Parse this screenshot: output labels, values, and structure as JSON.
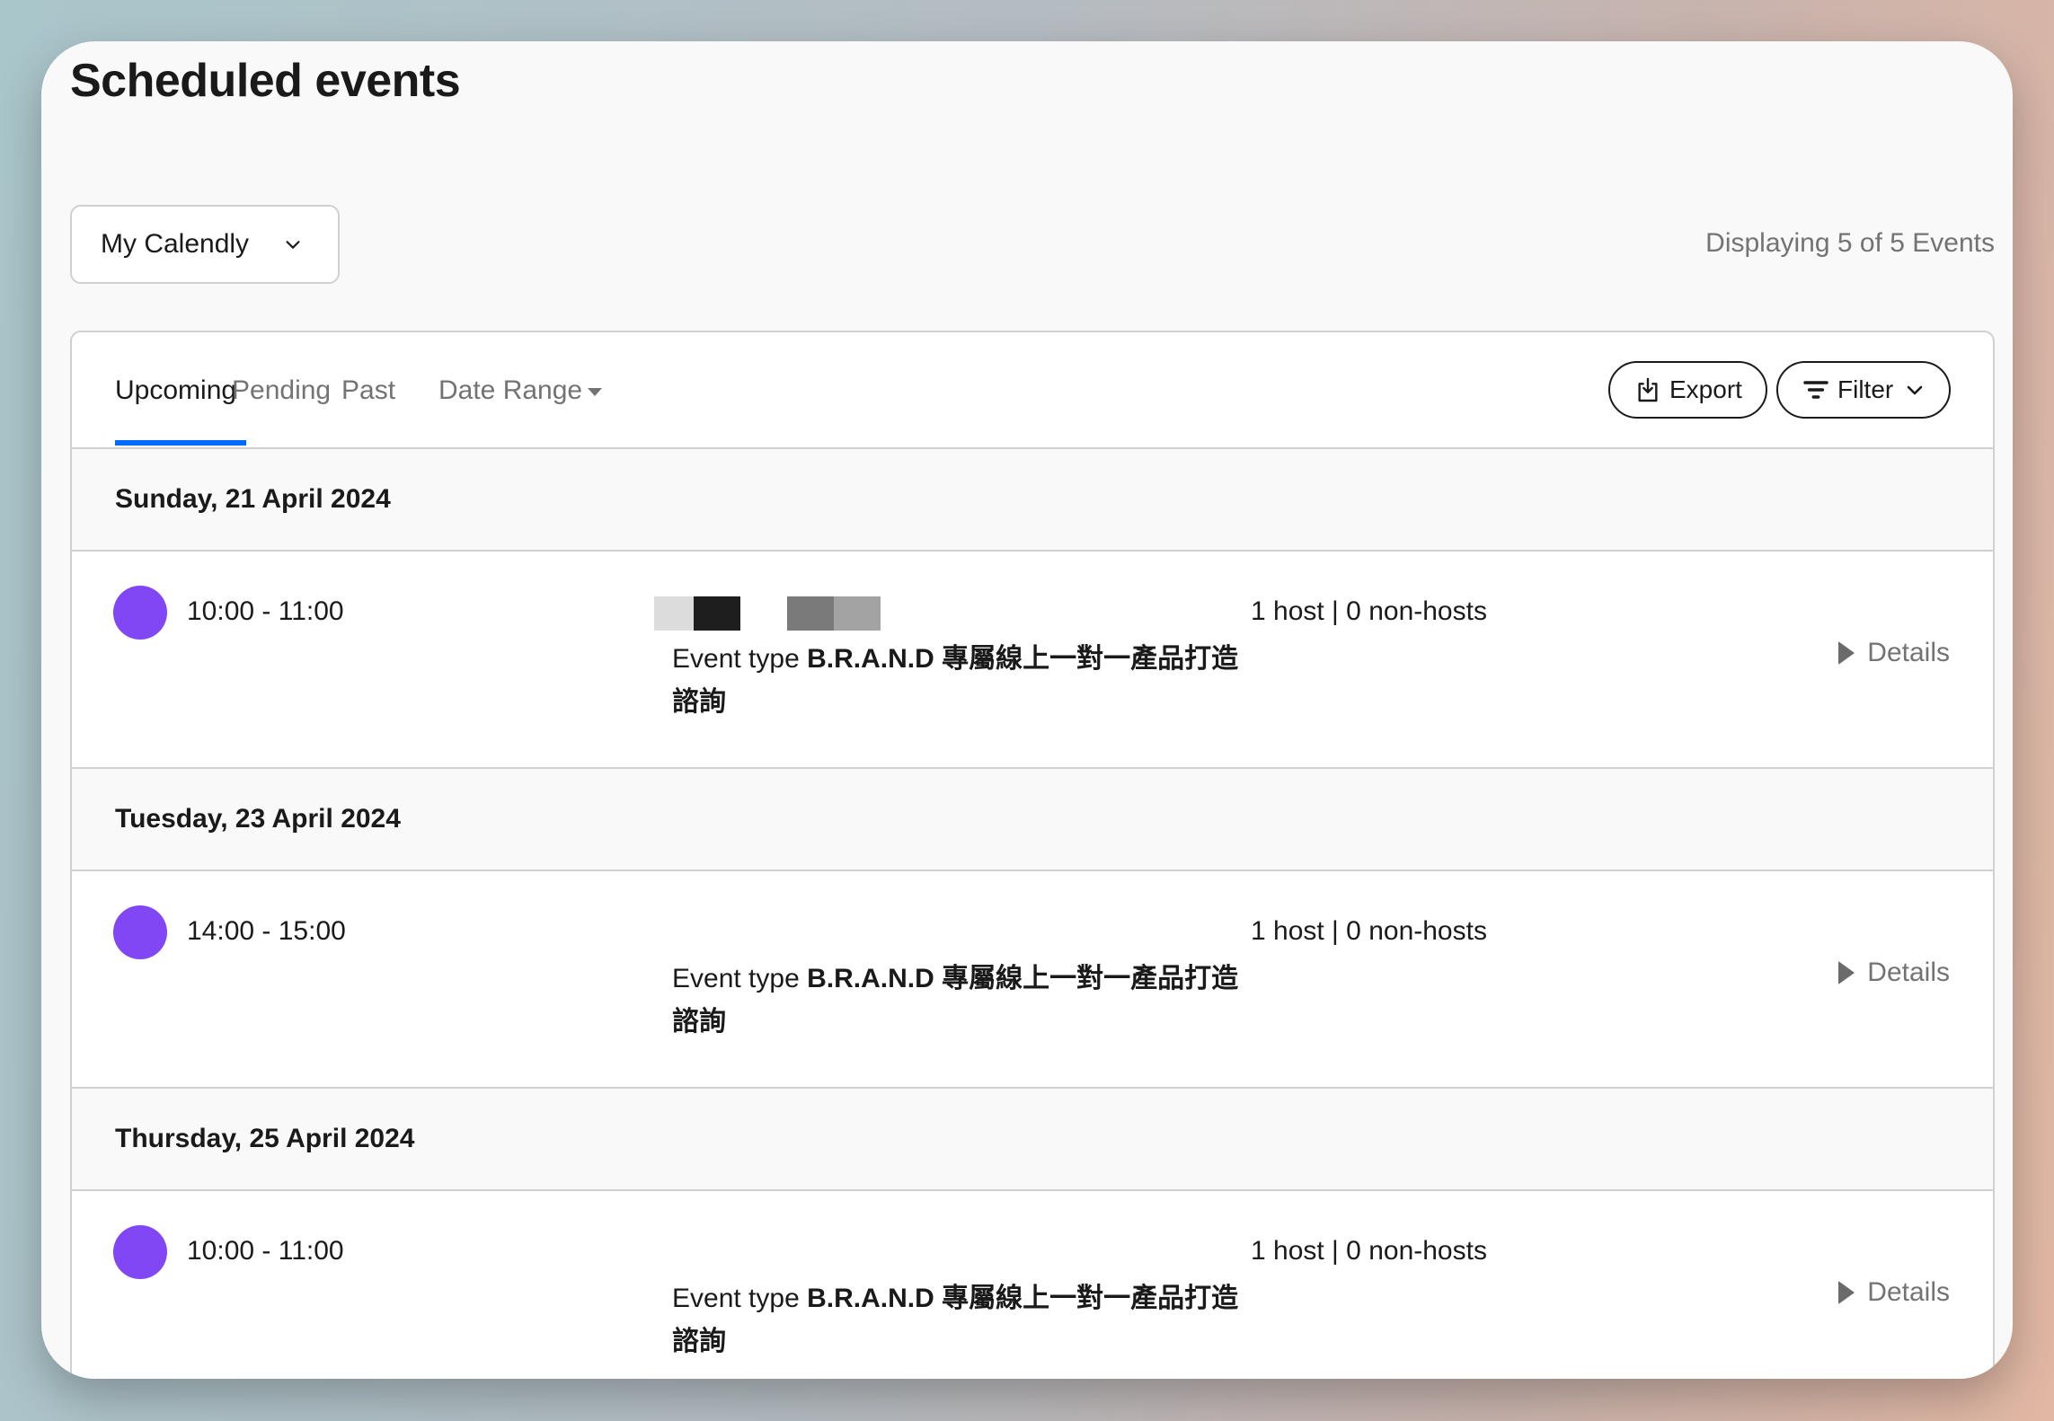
{
  "page": {
    "title": "Scheduled events",
    "calendar_select": {
      "value": "My Calendly",
      "icon": "chevron-down-icon"
    },
    "display_count": "Displaying 5 of 5 Events"
  },
  "tabs": [
    {
      "label": "Upcoming",
      "active": true
    },
    {
      "label": "Pending",
      "active": false
    },
    {
      "label": "Past",
      "active": false
    },
    {
      "label": "Date Range",
      "active": false,
      "icon": "caret-down-icon"
    }
  ],
  "toolbar": {
    "export_label": "Export",
    "export_icon": "export-download-icon",
    "filter_label": "Filter",
    "filter_icon": "filter-icon"
  },
  "colors": {
    "accent": "#006bff",
    "avatar": "#8247f5",
    "muted_text": "#737373",
    "border": "#d0d0d0"
  },
  "groups": [
    {
      "date": "Sunday, 21 April 2024",
      "events": [
        {
          "time": "10:00 - 11:00",
          "redacted_name": true,
          "hosts": "1 host | 0 non-hosts",
          "event_type_label": "Event type",
          "event_type_name": "B.R.A.N.D 專屬線上一對一產品打造諮詢",
          "details_label": "Details"
        }
      ]
    },
    {
      "date": "Tuesday, 23 April 2024",
      "events": [
        {
          "time": "14:00 - 15:00",
          "redacted_name": false,
          "hosts": "1 host | 0 non-hosts",
          "event_type_label": "Event type",
          "event_type_name": "B.R.A.N.D 專屬線上一對一產品打造諮詢",
          "details_label": "Details"
        }
      ]
    },
    {
      "date": "Thursday, 25 April 2024",
      "events": [
        {
          "time": "10:00 - 11:00",
          "redacted_name": false,
          "hosts": "1 host | 0 non-hosts",
          "event_type_label": "Event type",
          "event_type_name": "B.R.A.N.D 專屬線上一對一產品打造諮詢",
          "details_label": "Details"
        }
      ]
    }
  ]
}
